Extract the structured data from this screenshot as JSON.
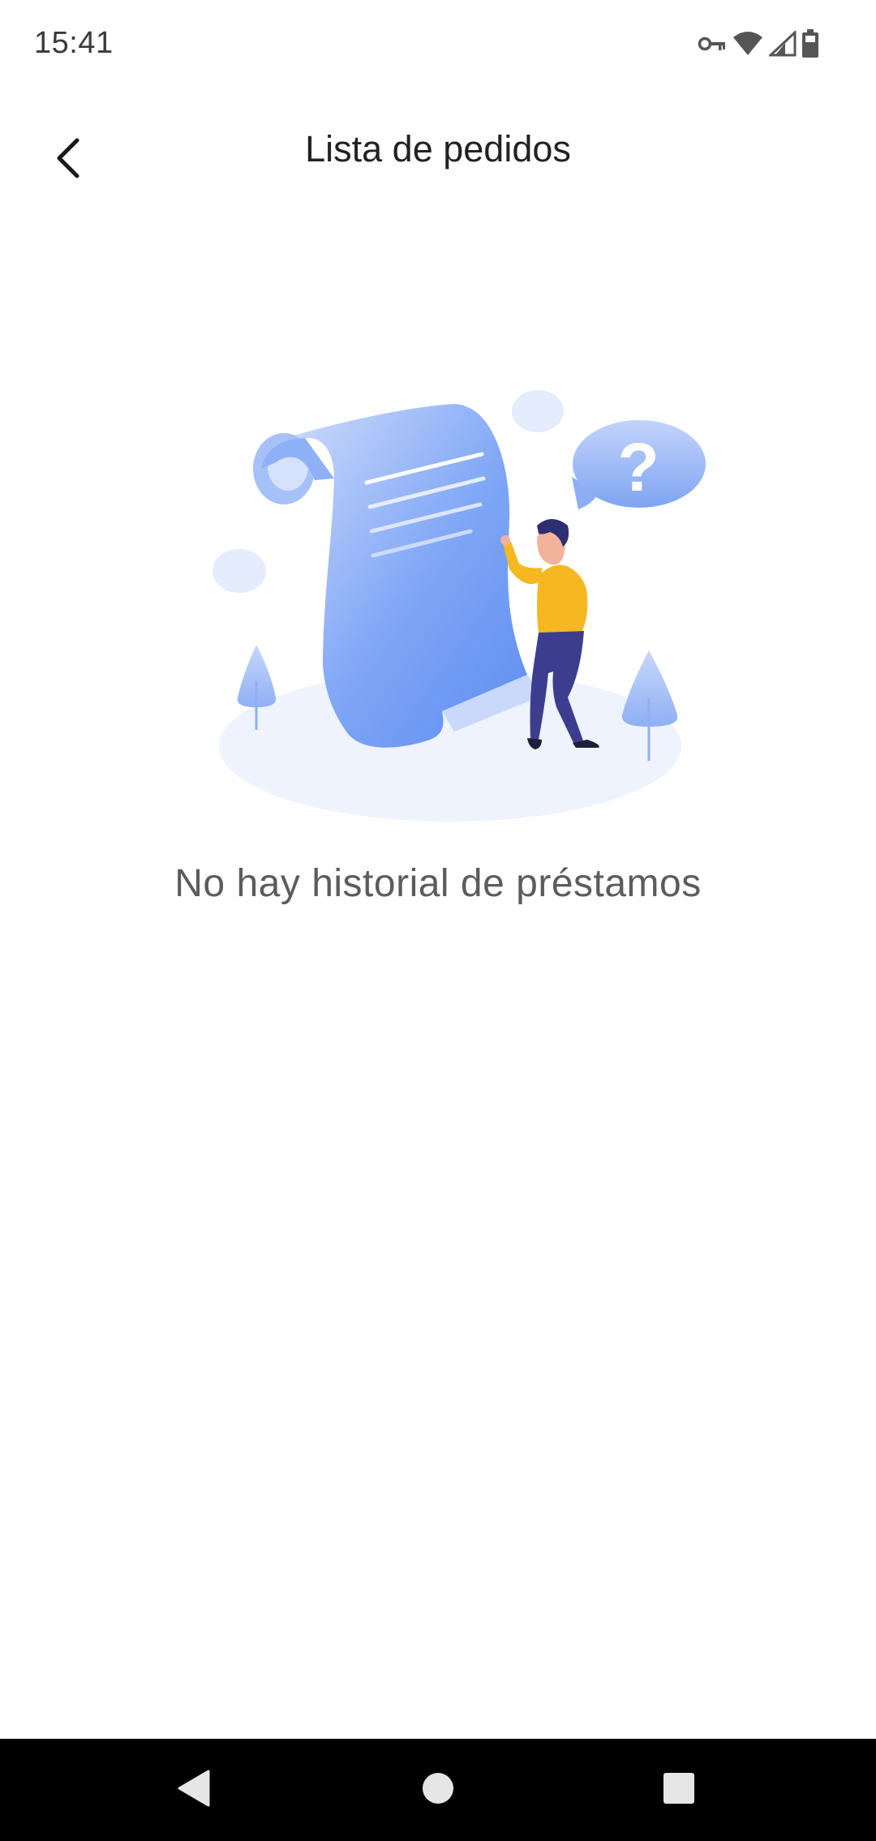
{
  "status_bar": {
    "time": "15:41",
    "icons": [
      "vpn-key-icon",
      "wifi-icon",
      "cell-signal-icon",
      "battery-icon"
    ]
  },
  "header": {
    "title": "Lista de pedidos",
    "back_icon": "chevron-left-icon"
  },
  "empty_state": {
    "message": "No hay historial de préstamos",
    "illustration": "document-scroll-person-question-illustration"
  },
  "navigation_bar": {
    "buttons": [
      "back-triangle-icon",
      "home-circle-icon",
      "recents-square-icon"
    ]
  },
  "colors": {
    "accent_blue": "#6f9cf5",
    "figure_yellow": "#f5b820",
    "figure_pants": "#3c3d8f",
    "text_primary": "#222222",
    "text_secondary": "#5c5c5c",
    "nav_bar": "#000000"
  }
}
